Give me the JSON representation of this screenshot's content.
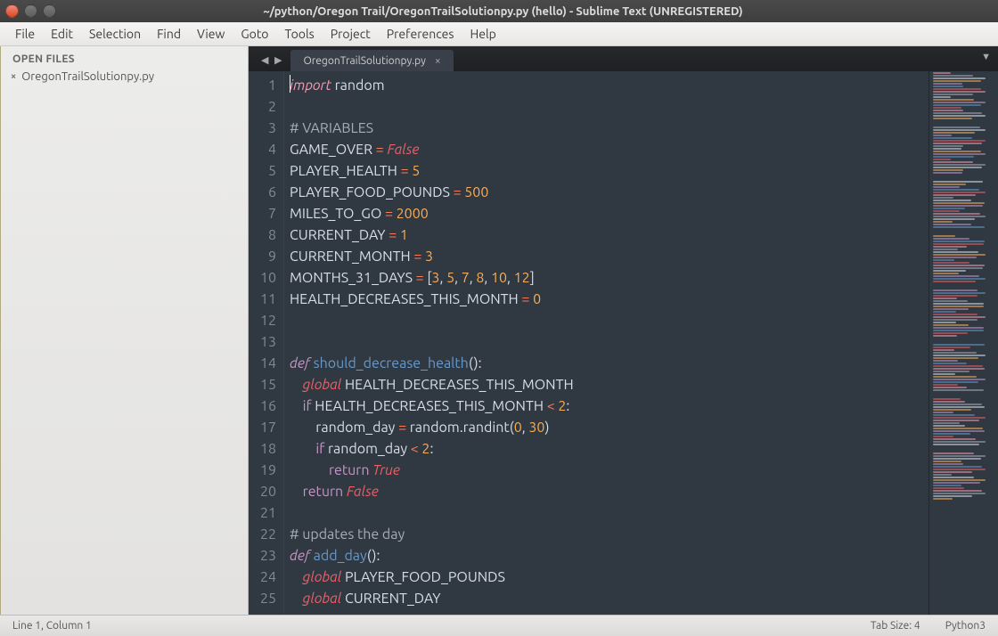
{
  "window": {
    "title": "~/python/Oregon Trail/OregonTrailSolutionpy.py (hello) - Sublime Text (UNREGISTERED)"
  },
  "menu": [
    "File",
    "Edit",
    "Selection",
    "Find",
    "View",
    "Goto",
    "Tools",
    "Project",
    "Preferences",
    "Help"
  ],
  "sidebar": {
    "header": "OPEN FILES",
    "files": [
      "OregonTrailSolutionpy.py"
    ]
  },
  "tab": {
    "label": "OregonTrailSolutionpy.py"
  },
  "code": {
    "lines": [
      [
        [
          "cursor",
          ""
        ],
        [
          "k-imp",
          "import"
        ],
        [
          "txt",
          " "
        ],
        [
          "txt",
          "random"
        ]
      ],
      [],
      [
        [
          "cm",
          "# VARIABLES"
        ]
      ],
      [
        [
          "txt",
          "GAME_OVER"
        ],
        [
          "txt",
          " "
        ],
        [
          "k-op",
          "="
        ],
        [
          "txt",
          " "
        ],
        [
          "k-const",
          "False"
        ]
      ],
      [
        [
          "txt",
          "PLAYER_HEALTH"
        ],
        [
          "txt",
          " "
        ],
        [
          "k-op",
          "="
        ],
        [
          "txt",
          " "
        ],
        [
          "k-num",
          "5"
        ]
      ],
      [
        [
          "txt",
          "PLAYER_FOOD_POUNDS"
        ],
        [
          "txt",
          " "
        ],
        [
          "k-op",
          "="
        ],
        [
          "txt",
          " "
        ],
        [
          "k-num",
          "500"
        ]
      ],
      [
        [
          "txt",
          "MILES_TO_GO"
        ],
        [
          "txt",
          " "
        ],
        [
          "k-op",
          "="
        ],
        [
          "txt",
          " "
        ],
        [
          "k-num",
          "2000"
        ]
      ],
      [
        [
          "txt",
          "CURRENT_DAY"
        ],
        [
          "txt",
          " "
        ],
        [
          "k-op",
          "="
        ],
        [
          "txt",
          " "
        ],
        [
          "k-num",
          "1"
        ]
      ],
      [
        [
          "txt",
          "CURRENT_MONTH"
        ],
        [
          "txt",
          " "
        ],
        [
          "k-op",
          "="
        ],
        [
          "txt",
          " "
        ],
        [
          "k-num",
          "3"
        ]
      ],
      [
        [
          "txt",
          "MONTHS_31_DAYS"
        ],
        [
          "txt",
          " "
        ],
        [
          "k-op",
          "="
        ],
        [
          "txt",
          " "
        ],
        [
          "paren",
          "["
        ],
        [
          "k-num",
          "3"
        ],
        [
          "txt",
          ", "
        ],
        [
          "k-num",
          "5"
        ],
        [
          "txt",
          ", "
        ],
        [
          "k-num",
          "7"
        ],
        [
          "txt",
          ", "
        ],
        [
          "k-num",
          "8"
        ],
        [
          "txt",
          ", "
        ],
        [
          "k-num",
          "10"
        ],
        [
          "txt",
          ", "
        ],
        [
          "k-num",
          "12"
        ],
        [
          "paren",
          "]"
        ]
      ],
      [
        [
          "txt",
          "HEALTH_DECREASES_THIS_MONTH"
        ],
        [
          "txt",
          " "
        ],
        [
          "k-op",
          "="
        ],
        [
          "txt",
          " "
        ],
        [
          "k-num",
          "0"
        ]
      ],
      [],
      [],
      [
        [
          "k-def",
          "def"
        ],
        [
          "txt",
          " "
        ],
        [
          "k-func",
          "should_decrease_health"
        ],
        [
          "paren",
          "():"
        ]
      ],
      [
        [
          "txt",
          "    "
        ],
        [
          "k-global",
          "global"
        ],
        [
          "txt",
          " HEALTH_DECREASES_THIS_MONTH"
        ]
      ],
      [
        [
          "txt",
          "    "
        ],
        [
          "k-kw",
          "if"
        ],
        [
          "txt",
          " HEALTH_DECREASES_THIS_MONTH "
        ],
        [
          "k-op",
          "<"
        ],
        [
          "txt",
          " "
        ],
        [
          "k-num",
          "2"
        ],
        [
          "txt",
          ":"
        ]
      ],
      [
        [
          "txt",
          "        random_day "
        ],
        [
          "k-op",
          "="
        ],
        [
          "txt",
          " random.randint("
        ],
        [
          "k-num",
          "0"
        ],
        [
          "txt",
          ", "
        ],
        [
          "k-num",
          "30"
        ],
        [
          "txt",
          ")"
        ]
      ],
      [
        [
          "txt",
          "        "
        ],
        [
          "k-kw",
          "if"
        ],
        [
          "txt",
          " random_day "
        ],
        [
          "k-op",
          "<"
        ],
        [
          "txt",
          " "
        ],
        [
          "k-num",
          "2"
        ],
        [
          "txt",
          ":"
        ]
      ],
      [
        [
          "txt",
          "            "
        ],
        [
          "k-ret",
          "return"
        ],
        [
          "txt",
          " "
        ],
        [
          "k-const",
          "True"
        ]
      ],
      [
        [
          "txt",
          "    "
        ],
        [
          "k-ret",
          "return"
        ],
        [
          "txt",
          " "
        ],
        [
          "k-const",
          "False"
        ]
      ],
      [],
      [
        [
          "cm",
          "# updates the day"
        ]
      ],
      [
        [
          "k-def",
          "def"
        ],
        [
          "txt",
          " "
        ],
        [
          "k-func",
          "add_day"
        ],
        [
          "paren",
          "():"
        ]
      ],
      [
        [
          "txt",
          "    "
        ],
        [
          "k-global",
          "global"
        ],
        [
          "txt",
          " PLAYER_FOOD_POUNDS"
        ]
      ],
      [
        [
          "txt",
          "    "
        ],
        [
          "k-global",
          "global"
        ],
        [
          "txt",
          " CURRENT_DAY"
        ]
      ]
    ]
  },
  "status": {
    "pos": "Line 1, Column 1",
    "tabsize": "Tab Size: 4",
    "syntax": "Python3"
  },
  "minimap_colors": [
    "#f49ab0",
    "#a6acb9",
    "#d8dee9",
    "#f9ae58",
    "#c695c6",
    "#6699cc",
    "#ec5f66"
  ]
}
